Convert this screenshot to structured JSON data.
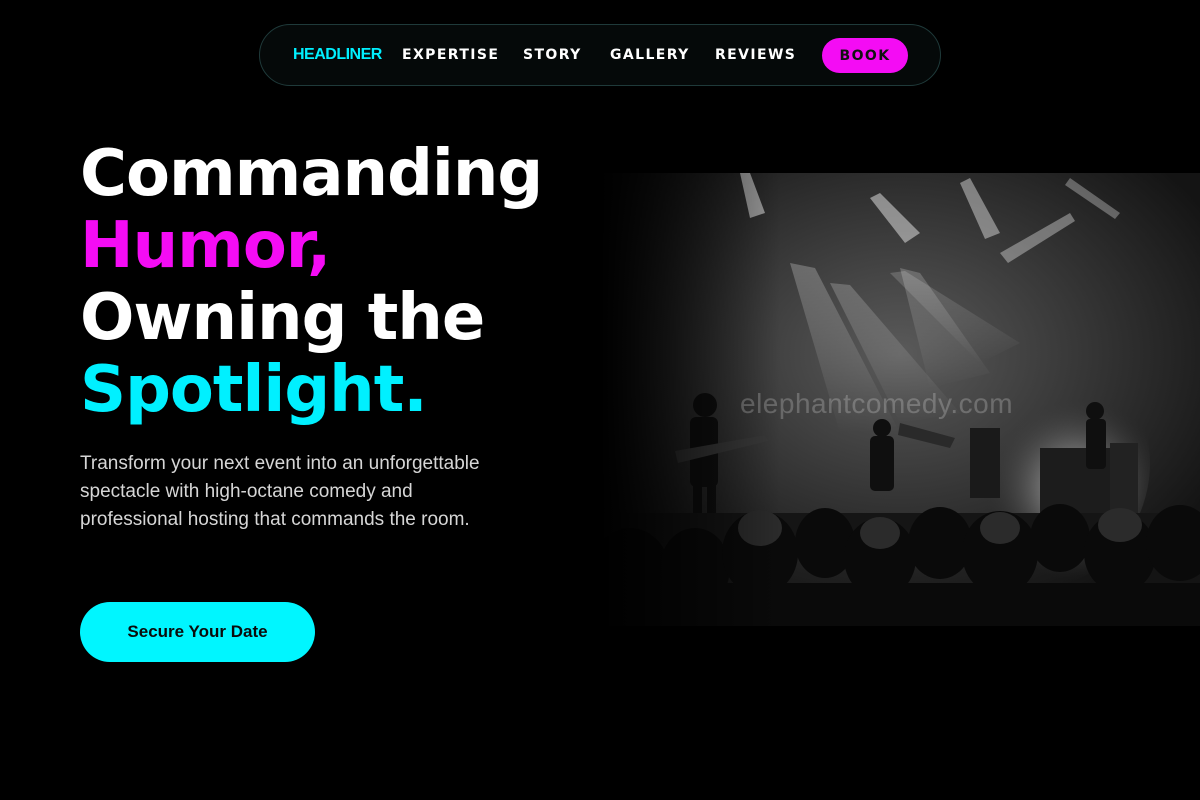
{
  "nav": {
    "brand": "HEADLINER",
    "links": [
      "EXPERTISE",
      "STORY",
      "GALLERY",
      "REVIEWS"
    ],
    "book_label": "BOOK"
  },
  "hero": {
    "headline": {
      "line1": "Commanding",
      "line2": "Humor,",
      "line3": "Owning the",
      "line4": "Spotlight."
    },
    "description": "Transform your next event into an unforgettable spectacle with high-octane comedy and professional hosting that commands the room.",
    "cta_label": "Secure Your Date",
    "image": {
      "subject": "black-and-white concert stage with band, stage lights and crowd",
      "watermark": "elephantcomedy.com"
    }
  },
  "colors": {
    "background": "#000000",
    "accent_cyan": "#00f0ff",
    "accent_magenta": "#f40cf4",
    "text": "#ffffff"
  }
}
